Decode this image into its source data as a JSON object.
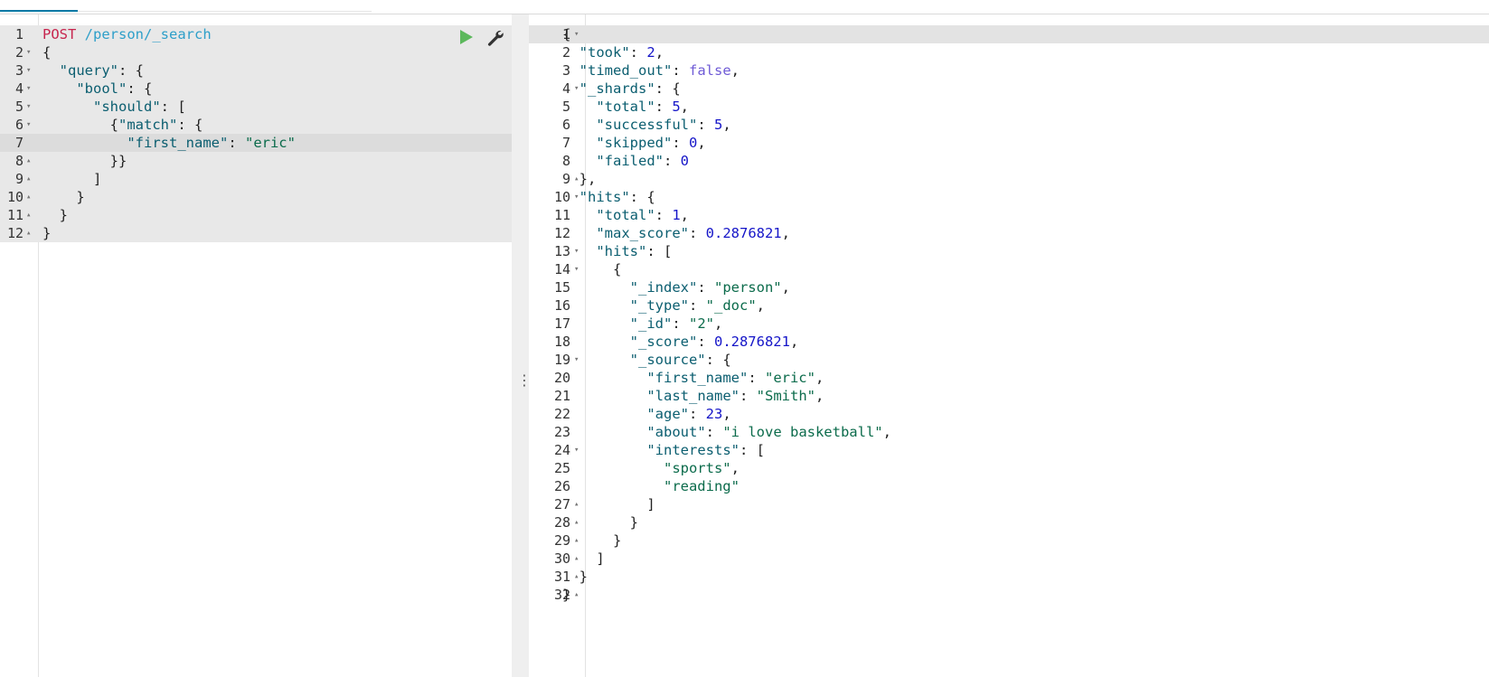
{
  "colors": {
    "method": "#c7254e",
    "path": "#2e9fc9",
    "key": "#0b5e70",
    "string": "#0b6b4b",
    "number": "#1515c8",
    "boolean": "#6f5bd6",
    "play": "#5cb85c"
  },
  "request": {
    "icons": {
      "run": "play-icon",
      "settings": "wrench-icon"
    },
    "lines": [
      {
        "n": "1",
        "fold": "",
        "active": false,
        "tokens": [
          {
            "t": "method",
            "v": "POST"
          },
          {
            "t": "punc",
            "v": " "
          },
          {
            "t": "path",
            "v": "/person/_search"
          }
        ]
      },
      {
        "n": "2",
        "fold": "open",
        "active": false,
        "tokens": [
          {
            "t": "punc",
            "v": "{"
          }
        ]
      },
      {
        "n": "3",
        "fold": "open",
        "active": false,
        "tokens": [
          {
            "t": "punc",
            "v": "  "
          },
          {
            "t": "key",
            "v": "\"query\""
          },
          {
            "t": "punc",
            "v": ": {"
          }
        ]
      },
      {
        "n": "4",
        "fold": "open",
        "active": false,
        "tokens": [
          {
            "t": "punc",
            "v": "    "
          },
          {
            "t": "key",
            "v": "\"bool\""
          },
          {
            "t": "punc",
            "v": ": {"
          }
        ]
      },
      {
        "n": "5",
        "fold": "open",
        "active": false,
        "tokens": [
          {
            "t": "punc",
            "v": "      "
          },
          {
            "t": "key",
            "v": "\"should\""
          },
          {
            "t": "punc",
            "v": ": ["
          }
        ]
      },
      {
        "n": "6",
        "fold": "open",
        "active": false,
        "tokens": [
          {
            "t": "punc",
            "v": "        {"
          },
          {
            "t": "key",
            "v": "\"match\""
          },
          {
            "t": "punc",
            "v": ": {"
          }
        ]
      },
      {
        "n": "7",
        "fold": "",
        "active": true,
        "tokens": [
          {
            "t": "punc",
            "v": "          "
          },
          {
            "t": "key",
            "v": "\"first_name\""
          },
          {
            "t": "punc",
            "v": ": "
          },
          {
            "t": "str",
            "v": "\"eric\""
          }
        ]
      },
      {
        "n": "8",
        "fold": "close",
        "active": false,
        "tokens": [
          {
            "t": "punc",
            "v": "        }}"
          }
        ]
      },
      {
        "n": "9",
        "fold": "close",
        "active": false,
        "tokens": [
          {
            "t": "punc",
            "v": "      ]"
          }
        ]
      },
      {
        "n": "10",
        "fold": "close",
        "active": false,
        "tokens": [
          {
            "t": "punc",
            "v": "    }"
          }
        ]
      },
      {
        "n": "11",
        "fold": "close",
        "active": false,
        "tokens": [
          {
            "t": "punc",
            "v": "  }"
          }
        ]
      },
      {
        "n": "12",
        "fold": "close",
        "active": false,
        "tokens": [
          {
            "t": "punc",
            "v": "}"
          }
        ]
      }
    ]
  },
  "divider": {
    "handle": "⋮"
  },
  "response": {
    "lines": [
      {
        "n": "1",
        "fold": "open",
        "active": true,
        "tokens": [
          {
            "t": "punc",
            "v": "{"
          }
        ]
      },
      {
        "n": "2",
        "fold": "",
        "active": false,
        "tokens": [
          {
            "t": "punc",
            "v": "  "
          },
          {
            "t": "key",
            "v": "\"took\""
          },
          {
            "t": "punc",
            "v": ": "
          },
          {
            "t": "num",
            "v": "2"
          },
          {
            "t": "punc",
            "v": ","
          }
        ]
      },
      {
        "n": "3",
        "fold": "",
        "active": false,
        "tokens": [
          {
            "t": "punc",
            "v": "  "
          },
          {
            "t": "key",
            "v": "\"timed_out\""
          },
          {
            "t": "punc",
            "v": ": "
          },
          {
            "t": "bool",
            "v": "false"
          },
          {
            "t": "punc",
            "v": ","
          }
        ]
      },
      {
        "n": "4",
        "fold": "open",
        "active": false,
        "tokens": [
          {
            "t": "punc",
            "v": "  "
          },
          {
            "t": "key",
            "v": "\"_shards\""
          },
          {
            "t": "punc",
            "v": ": {"
          }
        ]
      },
      {
        "n": "5",
        "fold": "",
        "active": false,
        "tokens": [
          {
            "t": "punc",
            "v": "    "
          },
          {
            "t": "key",
            "v": "\"total\""
          },
          {
            "t": "punc",
            "v": ": "
          },
          {
            "t": "num",
            "v": "5"
          },
          {
            "t": "punc",
            "v": ","
          }
        ]
      },
      {
        "n": "6",
        "fold": "",
        "active": false,
        "tokens": [
          {
            "t": "punc",
            "v": "    "
          },
          {
            "t": "key",
            "v": "\"successful\""
          },
          {
            "t": "punc",
            "v": ": "
          },
          {
            "t": "num",
            "v": "5"
          },
          {
            "t": "punc",
            "v": ","
          }
        ]
      },
      {
        "n": "7",
        "fold": "",
        "active": false,
        "tokens": [
          {
            "t": "punc",
            "v": "    "
          },
          {
            "t": "key",
            "v": "\"skipped\""
          },
          {
            "t": "punc",
            "v": ": "
          },
          {
            "t": "num",
            "v": "0"
          },
          {
            "t": "punc",
            "v": ","
          }
        ]
      },
      {
        "n": "8",
        "fold": "",
        "active": false,
        "tokens": [
          {
            "t": "punc",
            "v": "    "
          },
          {
            "t": "key",
            "v": "\"failed\""
          },
          {
            "t": "punc",
            "v": ": "
          },
          {
            "t": "num",
            "v": "0"
          }
        ]
      },
      {
        "n": "9",
        "fold": "close",
        "active": false,
        "tokens": [
          {
            "t": "punc",
            "v": "  },"
          }
        ]
      },
      {
        "n": "10",
        "fold": "open",
        "active": false,
        "tokens": [
          {
            "t": "punc",
            "v": "  "
          },
          {
            "t": "key",
            "v": "\"hits\""
          },
          {
            "t": "punc",
            "v": ": {"
          }
        ]
      },
      {
        "n": "11",
        "fold": "",
        "active": false,
        "tokens": [
          {
            "t": "punc",
            "v": "    "
          },
          {
            "t": "key",
            "v": "\"total\""
          },
          {
            "t": "punc",
            "v": ": "
          },
          {
            "t": "num",
            "v": "1"
          },
          {
            "t": "punc",
            "v": ","
          }
        ]
      },
      {
        "n": "12",
        "fold": "",
        "active": false,
        "tokens": [
          {
            "t": "punc",
            "v": "    "
          },
          {
            "t": "key",
            "v": "\"max_score\""
          },
          {
            "t": "punc",
            "v": ": "
          },
          {
            "t": "num",
            "v": "0.2876821"
          },
          {
            "t": "punc",
            "v": ","
          }
        ]
      },
      {
        "n": "13",
        "fold": "open",
        "active": false,
        "tokens": [
          {
            "t": "punc",
            "v": "    "
          },
          {
            "t": "key",
            "v": "\"hits\""
          },
          {
            "t": "punc",
            "v": ": ["
          }
        ]
      },
      {
        "n": "14",
        "fold": "open",
        "active": false,
        "tokens": [
          {
            "t": "punc",
            "v": "      {"
          }
        ]
      },
      {
        "n": "15",
        "fold": "",
        "active": false,
        "tokens": [
          {
            "t": "punc",
            "v": "        "
          },
          {
            "t": "key",
            "v": "\"_index\""
          },
          {
            "t": "punc",
            "v": ": "
          },
          {
            "t": "str",
            "v": "\"person\""
          },
          {
            "t": "punc",
            "v": ","
          }
        ]
      },
      {
        "n": "16",
        "fold": "",
        "active": false,
        "tokens": [
          {
            "t": "punc",
            "v": "        "
          },
          {
            "t": "key",
            "v": "\"_type\""
          },
          {
            "t": "punc",
            "v": ": "
          },
          {
            "t": "str",
            "v": "\"_doc\""
          },
          {
            "t": "punc",
            "v": ","
          }
        ]
      },
      {
        "n": "17",
        "fold": "",
        "active": false,
        "tokens": [
          {
            "t": "punc",
            "v": "        "
          },
          {
            "t": "key",
            "v": "\"_id\""
          },
          {
            "t": "punc",
            "v": ": "
          },
          {
            "t": "str",
            "v": "\"2\""
          },
          {
            "t": "punc",
            "v": ","
          }
        ]
      },
      {
        "n": "18",
        "fold": "",
        "active": false,
        "tokens": [
          {
            "t": "punc",
            "v": "        "
          },
          {
            "t": "key",
            "v": "\"_score\""
          },
          {
            "t": "punc",
            "v": ": "
          },
          {
            "t": "num",
            "v": "0.2876821"
          },
          {
            "t": "punc",
            "v": ","
          }
        ]
      },
      {
        "n": "19",
        "fold": "open",
        "active": false,
        "tokens": [
          {
            "t": "punc",
            "v": "        "
          },
          {
            "t": "key",
            "v": "\"_source\""
          },
          {
            "t": "punc",
            "v": ": {"
          }
        ]
      },
      {
        "n": "20",
        "fold": "",
        "active": false,
        "tokens": [
          {
            "t": "punc",
            "v": "          "
          },
          {
            "t": "key",
            "v": "\"first_name\""
          },
          {
            "t": "punc",
            "v": ": "
          },
          {
            "t": "str",
            "v": "\"eric\""
          },
          {
            "t": "punc",
            "v": ","
          }
        ]
      },
      {
        "n": "21",
        "fold": "",
        "active": false,
        "tokens": [
          {
            "t": "punc",
            "v": "          "
          },
          {
            "t": "key",
            "v": "\"last_name\""
          },
          {
            "t": "punc",
            "v": ": "
          },
          {
            "t": "str",
            "v": "\"Smith\""
          },
          {
            "t": "punc",
            "v": ","
          }
        ]
      },
      {
        "n": "22",
        "fold": "",
        "active": false,
        "tokens": [
          {
            "t": "punc",
            "v": "          "
          },
          {
            "t": "key",
            "v": "\"age\""
          },
          {
            "t": "punc",
            "v": ": "
          },
          {
            "t": "num",
            "v": "23"
          },
          {
            "t": "punc",
            "v": ","
          }
        ]
      },
      {
        "n": "23",
        "fold": "",
        "active": false,
        "tokens": [
          {
            "t": "punc",
            "v": "          "
          },
          {
            "t": "key",
            "v": "\"about\""
          },
          {
            "t": "punc",
            "v": ": "
          },
          {
            "t": "str",
            "v": "\"i love basketball\""
          },
          {
            "t": "punc",
            "v": ","
          }
        ]
      },
      {
        "n": "24",
        "fold": "open",
        "active": false,
        "tokens": [
          {
            "t": "punc",
            "v": "          "
          },
          {
            "t": "key",
            "v": "\"interests\""
          },
          {
            "t": "punc",
            "v": ": ["
          }
        ]
      },
      {
        "n": "25",
        "fold": "",
        "active": false,
        "tokens": [
          {
            "t": "punc",
            "v": "            "
          },
          {
            "t": "str",
            "v": "\"sports\""
          },
          {
            "t": "punc",
            "v": ","
          }
        ]
      },
      {
        "n": "26",
        "fold": "",
        "active": false,
        "tokens": [
          {
            "t": "punc",
            "v": "            "
          },
          {
            "t": "str",
            "v": "\"reading\""
          }
        ]
      },
      {
        "n": "27",
        "fold": "close",
        "active": false,
        "tokens": [
          {
            "t": "punc",
            "v": "          ]"
          }
        ]
      },
      {
        "n": "28",
        "fold": "close",
        "active": false,
        "tokens": [
          {
            "t": "punc",
            "v": "        }"
          }
        ]
      },
      {
        "n": "29",
        "fold": "close",
        "active": false,
        "tokens": [
          {
            "t": "punc",
            "v": "      }"
          }
        ]
      },
      {
        "n": "30",
        "fold": "close",
        "active": false,
        "tokens": [
          {
            "t": "punc",
            "v": "    ]"
          }
        ]
      },
      {
        "n": "31",
        "fold": "close",
        "active": false,
        "tokens": [
          {
            "t": "punc",
            "v": "  }"
          }
        ]
      },
      {
        "n": "32",
        "fold": "close",
        "active": false,
        "tokens": [
          {
            "t": "punc",
            "v": "}"
          }
        ]
      }
    ]
  }
}
